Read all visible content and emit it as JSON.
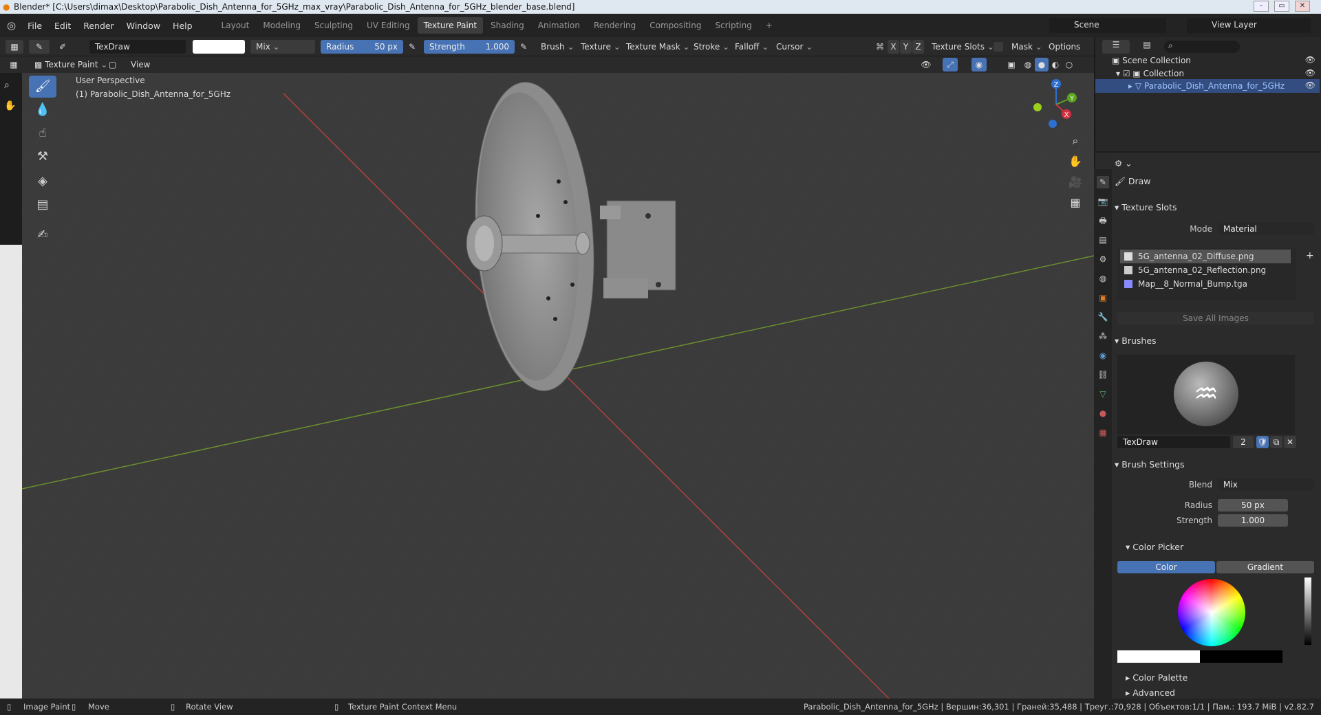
{
  "window": {
    "title": "Blender* [C:\\Users\\dimax\\Desktop\\Parabolic_Dish_Antenna_for_5GHz_max_vray\\Parabolic_Dish_Antenna_for_5GHz_blender_base.blend]"
  },
  "menu": [
    "File",
    "Edit",
    "Render",
    "Window",
    "Help"
  ],
  "workspaces": [
    "Layout",
    "Modeling",
    "Sculpting",
    "UV Editing",
    "Texture Paint",
    "Shading",
    "Animation",
    "Rendering",
    "Compositing",
    "Scripting"
  ],
  "active_workspace": "Texture Paint",
  "scene": {
    "name": "Scene",
    "view_layer": "View Layer"
  },
  "tool_header": {
    "brush": "TexDraw",
    "blend": "Mix",
    "radius_label": "Radius",
    "radius_value": "50 px",
    "strength_label": "Strength",
    "strength_value": "1.000",
    "menus": [
      "Brush",
      "Texture",
      "Texture Mask",
      "Stroke",
      "Falloff",
      "Cursor"
    ],
    "xyz": [
      "X",
      "Y",
      "Z"
    ],
    "texture_slots": "Texture Slots",
    "mask": "Mask",
    "options": "Options"
  },
  "mode_header": {
    "mode": "Texture Paint",
    "view": "View"
  },
  "viewport": {
    "perspective": "User Perspective",
    "object": "(1) Parabolic_Dish_Antenna_for_5GHz",
    "gizmo": {
      "z": "Z",
      "y": "Y",
      "x": "X"
    }
  },
  "outliner": {
    "scene_collection": "Scene Collection",
    "collection": "Collection",
    "object": "Parabolic_Dish_Antenna_for_5GHz"
  },
  "properties": {
    "tool_name": "Draw",
    "texture_slots": {
      "title": "Texture Slots",
      "mode_label": "Mode",
      "mode_value": "Material",
      "slots": [
        "5G_antenna_02_Diffuse.png",
        "5G_antenna_02_Reflection.png",
        "Map__8_Normal_Bump.tga"
      ],
      "save_all": "Save All Images"
    },
    "brushes": {
      "title": "Brushes",
      "brush_name": "TexDraw",
      "users": "2"
    },
    "brush_settings": {
      "title": "Brush Settings",
      "blend_label": "Blend",
      "blend_value": "Mix",
      "radius_label": "Radius",
      "radius_value": "50 px",
      "strength_label": "Strength",
      "strength_value": "1.000"
    },
    "color_picker": {
      "title": "Color Picker",
      "tab_color": "Color",
      "tab_gradient": "Gradient"
    },
    "color_palette": "Color Palette",
    "advanced": "Advanced"
  },
  "statusbar": {
    "image_paint": "Image Paint",
    "move": "Move",
    "rotate": "Rotate View",
    "context_menu": "Texture Paint Context Menu",
    "stats": "Parabolic_Dish_Antenna_for_5GHz | Вершин:36,301 | Граней:35,488 | Треуг.:70,928 | Объектов:1/1 | Пам.: 193.7 MiB | v2.82.7"
  },
  "colors": {
    "accent": "#4772b3",
    "viewport_bg": "#3b3b3b",
    "x_axis": "#b5403f",
    "y_axis": "#6a8f2e"
  }
}
